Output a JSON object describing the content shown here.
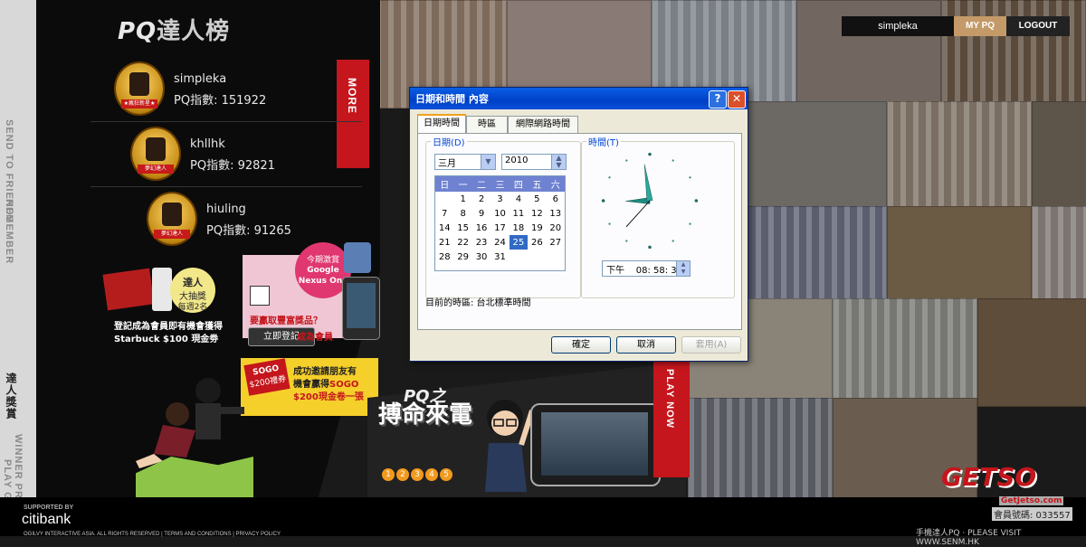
{
  "site": {
    "brand_prefix": "PQ",
    "brand_suffix": "達人榜",
    "more_tab": "MORE",
    "play_now": "PLAY NOW",
    "side_labels": [
      "SEND TO FRIENDS",
      "REMEMBER",
      "達人獎賞",
      "WINNER PRIZE",
      "PLAY GAME"
    ],
    "topbar": {
      "username": "simpleka",
      "my_pq": "MY PQ",
      "logout": "LOGOUT"
    }
  },
  "leaderboard": [
    {
      "name": "simpleka",
      "score_label": "PQ指數: 151922",
      "badge_text": "★瘋狂新星★"
    },
    {
      "name": "khllhk",
      "score_label": "PQ指數: 92821",
      "badge_text": "夢幻達人"
    },
    {
      "name": "hiuling",
      "score_label": "PQ指數: 91265",
      "badge_text": "夢幻達人"
    }
  ],
  "promos": {
    "starbuck": {
      "bubble_line1": "達人",
      "bubble_line2": "大抽獎",
      "bubble_line3": "每週2名",
      "line1": "登記成為會員即有機會獲得",
      "line2": "Starbuck $100 現金劵"
    },
    "nexus": {
      "bubble_line1": "今期激賞",
      "bubble_line2": "Google",
      "bubble_line3": "Nexus One",
      "question": "要贏取豐富獎品？",
      "register_button": "立即登記",
      "register_suffix": "成為會員"
    },
    "sogo": {
      "card_line1": "SOGO",
      "card_line2": "$200禮券",
      "line1": "成功邀請朋友有",
      "line2": "機會贏得",
      "line2_brand": "SOGO",
      "line3": "$200現金卷一張"
    }
  },
  "game": {
    "pq": "PQ之",
    "title": "搏命來電",
    "levels": [
      "1",
      "2",
      "3",
      "4",
      "5"
    ]
  },
  "footer": {
    "supported_by": "SUPPORTED BY",
    "sponsor": "citibank",
    "copyright": "OGILVY INTERACTIVE ASIA. ALL RIGHTS RESERVED  |  TERMS AND CONDITIONS  |  PRIVACY POLICY",
    "right_text": "手機達人PQ  ·  PLEASE VISIT WWW.SENM.HK"
  },
  "watermark": {
    "logo": "GETSO",
    "url": "GetJetso.com",
    "reg": "會員號碼: 033557"
  },
  "dialog": {
    "title": "日期和時間 內容",
    "help": "?",
    "close": "✕",
    "tabs": [
      "日期時間",
      "時區",
      "網際網路時間"
    ],
    "active_tab": 0,
    "date_group": "日期(D)",
    "time_group": "時間(T)",
    "month": "三月",
    "year": "2010",
    "weekday_headers": [
      "日",
      "一",
      "二",
      "三",
      "四",
      "五",
      "六"
    ],
    "weeks": [
      [
        "",
        "1",
        "2",
        "3",
        "4",
        "5",
        "6"
      ],
      [
        "7",
        "8",
        "9",
        "10",
        "11",
        "12",
        "13"
      ],
      [
        "14",
        "15",
        "16",
        "17",
        "18",
        "19",
        "20"
      ],
      [
        "21",
        "22",
        "23",
        "24",
        "25",
        "26",
        "27"
      ],
      [
        "28",
        "29",
        "30",
        "31",
        "",
        "",
        ""
      ]
    ],
    "selected_day": "25",
    "time": "下午    08: 58: 37",
    "clock": {
      "hour": 8,
      "minute": 58,
      "second": 37
    },
    "timezone": "目前的時區: 台北標準時間",
    "ok": "確定",
    "cancel": "取消",
    "apply": "套用(A)"
  },
  "colors": {
    "accent_red": "#c4161c",
    "xp_title": "#0a5ee6",
    "selected_day_bg": "#316ac5",
    "clock_hand": "#1f8a80"
  }
}
